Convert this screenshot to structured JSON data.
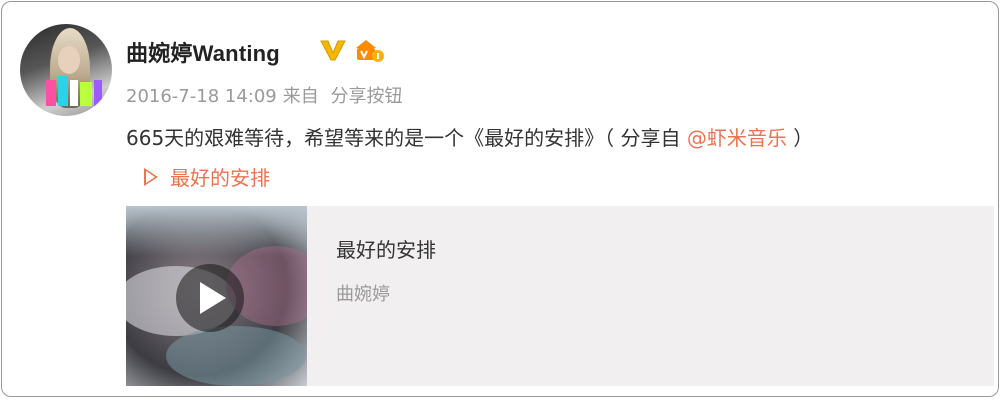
{
  "post": {
    "author": "曲婉婷Wanting",
    "timestamp": "2016-7-18 14:09",
    "source_prefix": "来自",
    "source": "分享按钮",
    "text_main": "665天的艰难等待，希望等来的是一个《最好的安排》（ 分享自 ",
    "mention": "@虾米音乐",
    "text_close": " ）",
    "link_label": "最好的安排"
  },
  "music_card": {
    "title": "最好的安排",
    "artist": "曲婉婷"
  },
  "icons": {
    "verified": "verified-v-icon",
    "vip": "vip-badge-icon",
    "link": "play-link-icon",
    "play": "play-icon"
  },
  "colors": {
    "accent_orange": "#eb7350",
    "verified_gold": "#f5b800",
    "meta_gray": "#9a9a9a",
    "card_bg": "#f1efef"
  }
}
